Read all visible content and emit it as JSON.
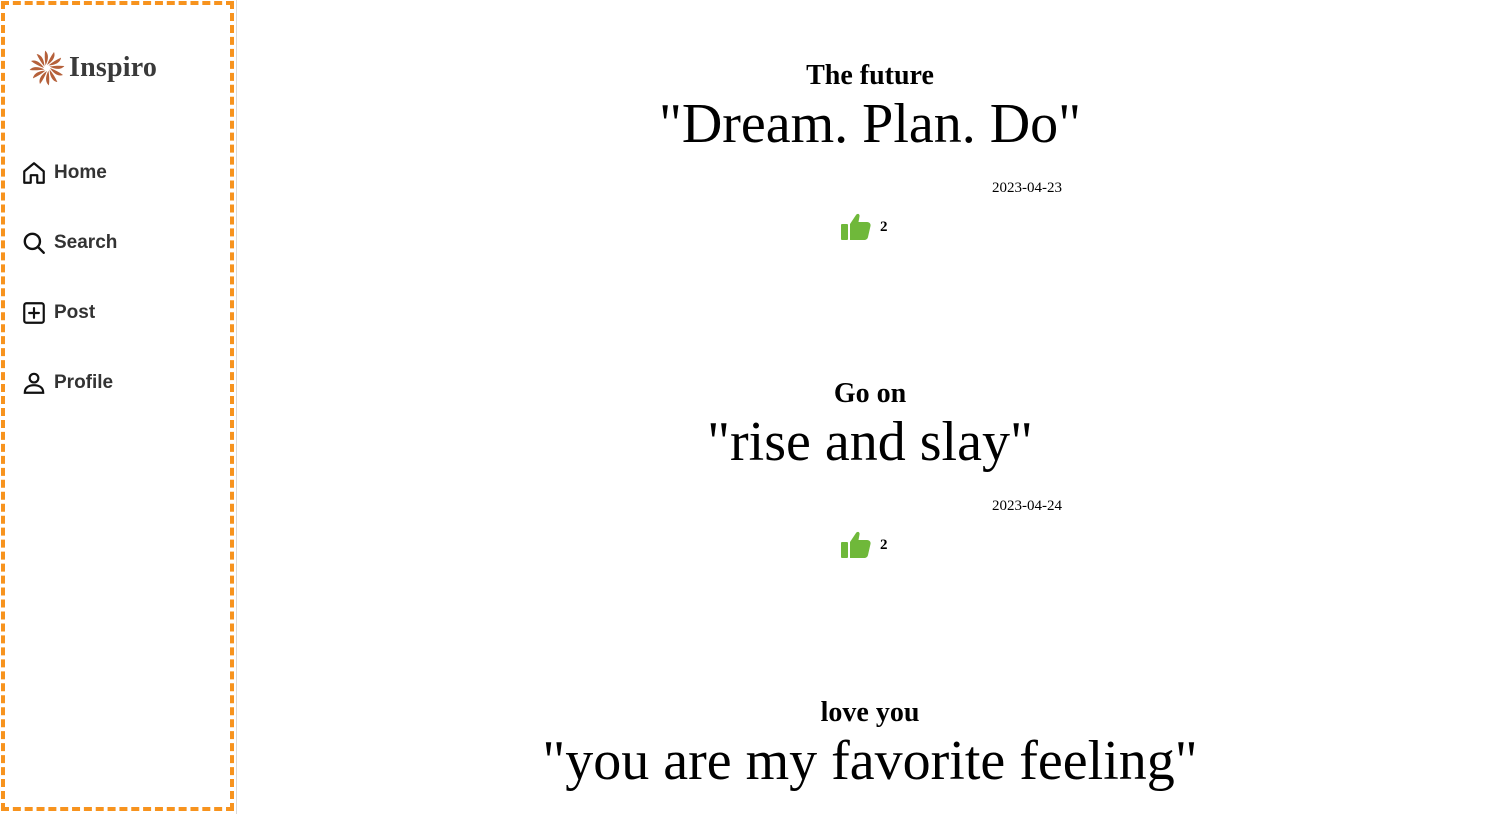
{
  "app": {
    "logo_text": "Inspiro"
  },
  "sidebar": {
    "items": [
      {
        "label": "Home",
        "icon": "home-icon"
      },
      {
        "label": "Search",
        "icon": "search-icon"
      },
      {
        "label": "Post",
        "icon": "add-square-icon"
      },
      {
        "label": "Profile",
        "icon": "user-icon"
      }
    ]
  },
  "feed": {
    "posts": [
      {
        "title": "The future",
        "quote": "\"Dream. Plan. Do\"",
        "date": "2023-04-23",
        "likes": "2"
      },
      {
        "title": "Go on",
        "quote": "\"rise and slay\"",
        "date": "2023-04-24",
        "likes": "2"
      },
      {
        "title": "love you",
        "quote": "\"you are my favorite feeling\""
      }
    ]
  },
  "colors": {
    "accent_border": "#f7931e",
    "like": "#6fb83a",
    "logo": "#b5603a",
    "text": "#333333"
  }
}
